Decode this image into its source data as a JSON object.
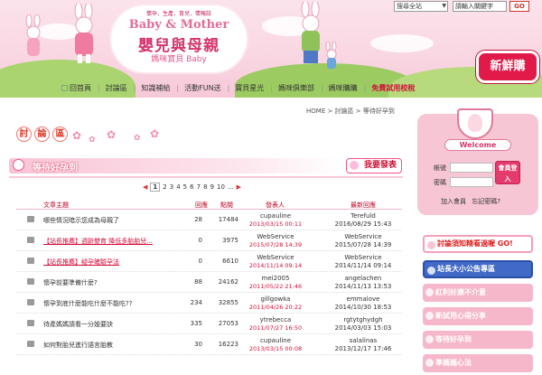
{
  "header": {
    "logo_tagline": "懷孕．生產．育兒．情報誌",
    "logo_en": "Baby & Mother",
    "logo_cn": "嬰兒與母親",
    "logo_sub": "媽咪寶貝 Baby",
    "search_scope": "搜尋全站",
    "keyword_placeholder": "請輸入關鍵字",
    "go_label": "GO",
    "new_badge": "新鮮購",
    "nav": [
      {
        "label": "回首頁"
      },
      {
        "label": "討論區"
      },
      {
        "label": "知識補給"
      },
      {
        "label": "活動FUN送"
      },
      {
        "label": "寶貝星光"
      },
      {
        "label": "媽咪俱樂部"
      },
      {
        "label": "媽咪購購"
      },
      {
        "label": "免費試用校稅"
      }
    ]
  },
  "breadcrumb": "HOME > 討論區 > 等待好孕到",
  "board": {
    "title_chars": [
      "討",
      "論",
      "區"
    ],
    "section": "等待好孕到",
    "post_button": "我要發表"
  },
  "pager": {
    "pages": [
      "1",
      "2",
      "3",
      "4",
      "5",
      "6",
      "7",
      "8",
      "9",
      "10",
      "..."
    ],
    "current": "1"
  },
  "table": {
    "headers": {
      "subject": "文章主題",
      "replies": "回應",
      "views": "點閱",
      "author": "發表人",
      "last": "最新回應"
    },
    "rows": [
      {
        "subject": "哪些情況暗示您成為母親了",
        "promo": false,
        "replies": "28",
        "views": "17484",
        "author": "cupauline",
        "date": "2013/03/15 00:11",
        "last_user": "Terefuld",
        "last_date": "2016/08/29 15:43"
      },
      {
        "subject": "【站長推薦】週齡嬰育 降低多胎胎兒...",
        "promo": true,
        "replies": "0",
        "views": "3975",
        "author": "WebService",
        "date": "2015/07/28 14:39",
        "last_user": "WebService",
        "last_date": "2015/07/28 14:39"
      },
      {
        "subject": "【站長推薦】疑孕確驗孕法",
        "promo": true,
        "replies": "0",
        "views": "6610",
        "author": "WebService",
        "date": "2014/11/14 09:14",
        "last_user": "WebService",
        "last_date": "2014/11/14 09:14"
      },
      {
        "subject": "懷孕前要準備什麼?",
        "promo": false,
        "replies": "88",
        "views": "24162",
        "author": "mei2005",
        "date": "2011/05/22 21:46",
        "last_user": "angelachen",
        "last_date": "2014/11/13 13:53"
      },
      {
        "subject": "懷孕到底什麼能吃什麼不能吃??",
        "promo": false,
        "replies": "234",
        "views": "32855",
        "author": "gillgowka",
        "date": "2011/04/26 20:22",
        "last_user": "emmalove",
        "last_date": "2014/10/30 18:53"
      },
      {
        "subject": "待產媽媽請看一分娩要訣",
        "promo": false,
        "replies": "335",
        "views": "27053",
        "author": "ytrebecca",
        "date": "2011/07/27 16:50",
        "last_user": "rgtytghydgh",
        "last_date": "2014/03/03 15:03"
      },
      {
        "subject": "如何對胎兒進行語言胎教",
        "promo": false,
        "replies": "30",
        "views": "16223",
        "author": "cupauline",
        "date": "2013/03/15 00:08",
        "last_user": "salalinas",
        "last_date": "2013/12/17 17:46"
      }
    ]
  },
  "login": {
    "welcome": "Welcome",
    "account_label": "帳號",
    "password_label": "密碼",
    "login_button": "會員登入",
    "join_label": "加入會員",
    "forgot_label": "忘記密碼?"
  },
  "sidebar_buttons": [
    {
      "label": "討論須知精看過喔 GO!"
    },
    {
      "label": "站長大小公告專區"
    },
    {
      "label": "紅利好康不介意"
    },
    {
      "label": "新試用心得分享"
    },
    {
      "label": "等待好孕到"
    },
    {
      "label": "準媽媽心法"
    }
  ],
  "colors": {
    "accent": "#e11a4a",
    "pink": "#f7c6d4",
    "blue": "#4169c8"
  }
}
